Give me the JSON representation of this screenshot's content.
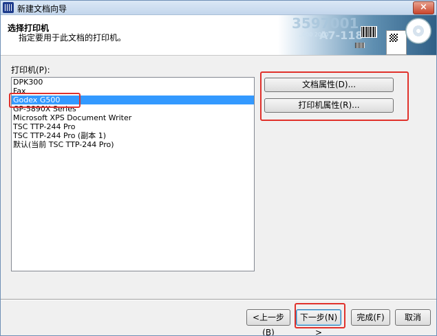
{
  "window": {
    "title": "新建文档向导",
    "close_glyph": "×"
  },
  "header": {
    "title": "选择打印机",
    "subtitle": "指定要用于此文档的打印机。",
    "art_text_1": "3597001",
    "art_text_2": "A7-118",
    "art_text_3": "..000 2000"
  },
  "printer_list": {
    "label": "打印机(P):",
    "items": [
      {
        "label": "DPK300",
        "selected": false
      },
      {
        "label": "Fax",
        "selected": false
      },
      {
        "label": "Godex G500",
        "selected": true
      },
      {
        "label": "GP-5890X Series",
        "selected": false
      },
      {
        "label": "Microsoft XPS Document Writer",
        "selected": false
      },
      {
        "label": "TSC TTP-244 Pro",
        "selected": false
      },
      {
        "label": "TSC TTP-244 Pro (副本 1)",
        "selected": false
      },
      {
        "label": "默认(当前 TSC TTP-244 Pro)",
        "selected": false
      }
    ]
  },
  "buttons": {
    "doc_properties": "文档属性(D)...",
    "printer_properties": "打印机属性(R)...",
    "back": "<上一步(B)",
    "next": "下一步(N) >",
    "finish": "完成(F)",
    "cancel": "取消"
  },
  "colors": {
    "selection": "#3399ff",
    "annotation": "#e0302a"
  }
}
